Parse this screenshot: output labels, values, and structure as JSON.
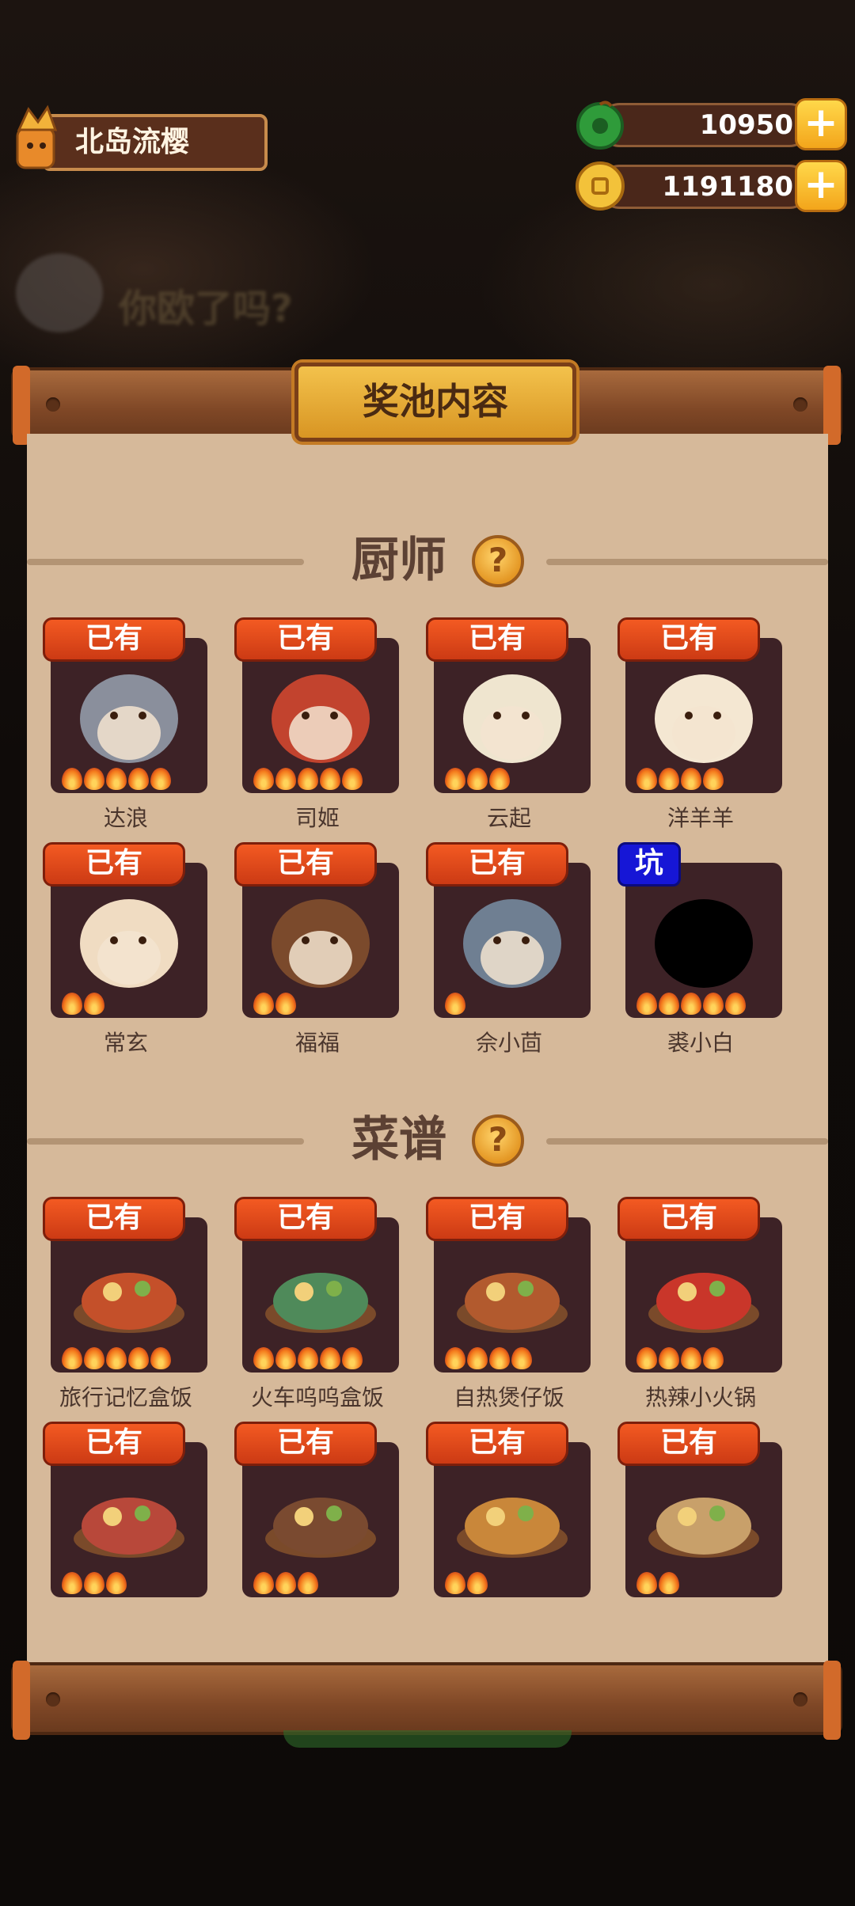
{
  "player": {
    "name": "北岛流樱"
  },
  "currency": {
    "jade": {
      "amount": "10950",
      "icon": "jade-coin-icon"
    },
    "gold": {
      "amount": "1191180",
      "icon": "gold-coin-icon"
    }
  },
  "background": {
    "banner_text": "你欧了吗?"
  },
  "panel": {
    "title": "奖池内容",
    "chef_section": {
      "label": "厨师",
      "help_symbol": "?",
      "items": [
        {
          "badge": "已有",
          "name": "达浪",
          "stars": 5,
          "art": "#8a8f9c"
        },
        {
          "badge": "已有",
          "name": "司姬",
          "stars": 5,
          "art": "#c2432e"
        },
        {
          "badge": "已有",
          "name": "云起",
          "stars": 3,
          "art": "#efe5cf"
        },
        {
          "badge": "已有",
          "name": "洋羊羊",
          "stars": 4,
          "art": "#f4e7d2"
        },
        {
          "badge": "已有",
          "name": "常玄",
          "stars": 2,
          "art": "#f0dcc2"
        },
        {
          "badge": "已有",
          "name": "福福",
          "stars": 2,
          "art": "#7b4a2c"
        },
        {
          "badge": "已有",
          "name": "佘小茴",
          "stars": 1,
          "art": "#6f7f92"
        },
        {
          "badge": "坑",
          "name": "裘小白",
          "stars": 5,
          "art": "#000000"
        }
      ]
    },
    "recipe_section": {
      "label": "菜谱",
      "help_symbol": "?",
      "items": [
        {
          "badge": "已有",
          "name": "旅行记忆盒饭",
          "stars": 5,
          "art": "#c4502a"
        },
        {
          "badge": "已有",
          "name": "火车呜呜盒饭",
          "stars": 5,
          "art": "#4f8a5a"
        },
        {
          "badge": "已有",
          "name": "自热煲仔饭",
          "stars": 4,
          "art": "#b25a2e"
        },
        {
          "badge": "已有",
          "name": "热辣小火锅",
          "stars": 4,
          "art": "#c9362a"
        },
        {
          "badge": "已有",
          "name": "",
          "stars": 3,
          "art": "#b8483a"
        },
        {
          "badge": "已有",
          "name": "",
          "stars": 3,
          "art": "#7a4a30"
        },
        {
          "badge": "已有",
          "name": "",
          "stars": 2,
          "art": "#c9873a"
        },
        {
          "badge": "已有",
          "name": "",
          "stars": 2,
          "art": "#c8a06a"
        }
      ]
    }
  },
  "colors": {
    "badge_owned": "#e0461a",
    "badge_pit": "#1616d6",
    "paper": "#d6b99a",
    "card_frame": "#3d2226"
  }
}
